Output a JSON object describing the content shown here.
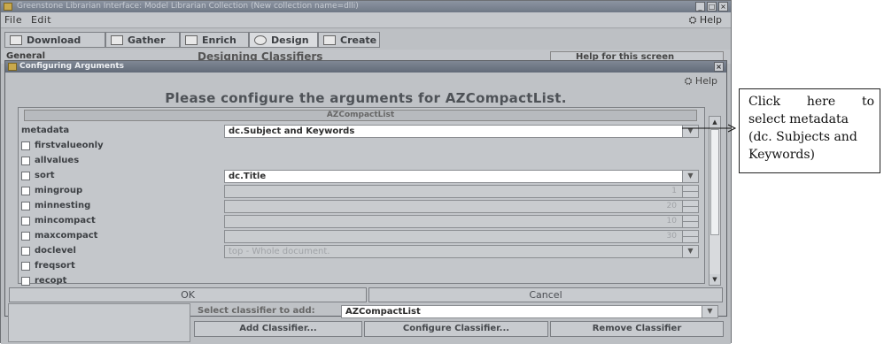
{
  "window": {
    "title": "Greenstone Librarian Interface: Model Librarian Collection (New collection name=dlli)",
    "controls": [
      "_",
      "□",
      "×"
    ]
  },
  "menu": {
    "file": "File",
    "edit": "Edit",
    "help": "Help"
  },
  "tabs": [
    {
      "label": "Download",
      "icon": "download-icon"
    },
    {
      "label": "Gather",
      "icon": "gather-icon"
    },
    {
      "label": "Enrich",
      "icon": "enrich-icon"
    },
    {
      "label": "Design",
      "icon": "design-icon"
    },
    {
      "label": "Create",
      "icon": "create-icon"
    }
  ],
  "background": {
    "general": "General",
    "designing": "Designing Classifiers",
    "help_screen": "Help for this screen"
  },
  "dialog": {
    "title": "Configuring Arguments",
    "help": "Help",
    "heading": "Please configure the arguments for AZCompactList.",
    "classifier_header": "AZCompactList",
    "args": {
      "metadata": {
        "label": "metadata",
        "value": "dc.Subject and Keywords"
      },
      "firstvalueonly": {
        "label": "firstvalueonly"
      },
      "allvalues": {
        "label": "allvalues"
      },
      "sort": {
        "label": "sort",
        "value": "dc.Title"
      },
      "mingroup": {
        "label": "mingroup",
        "value": "1"
      },
      "minnesting": {
        "label": "minnesting",
        "value": "20"
      },
      "mincompact": {
        "label": "mincompact",
        "value": "10"
      },
      "maxcompact": {
        "label": "maxcompact",
        "value": "30"
      },
      "doclevel": {
        "label": "doclevel",
        "value": "top - Whole document."
      },
      "freqsort": {
        "label": "freqsort"
      },
      "recopt": {
        "label": "recopt"
      }
    },
    "ok": "OK",
    "cancel": "Cancel"
  },
  "bottom": {
    "select_label": "Select classifier to add:",
    "select_value": "AZCompactList",
    "add": "Add Classifier...",
    "configure": "Configure Classifier...",
    "remove": "Remove Classifier"
  },
  "callout": {
    "line1_a": "Click",
    "line1_b": "here",
    "line1_c": "to",
    "line2": "select metadata",
    "line3": "(dc. Subjects and",
    "line4": "Keywords)"
  }
}
